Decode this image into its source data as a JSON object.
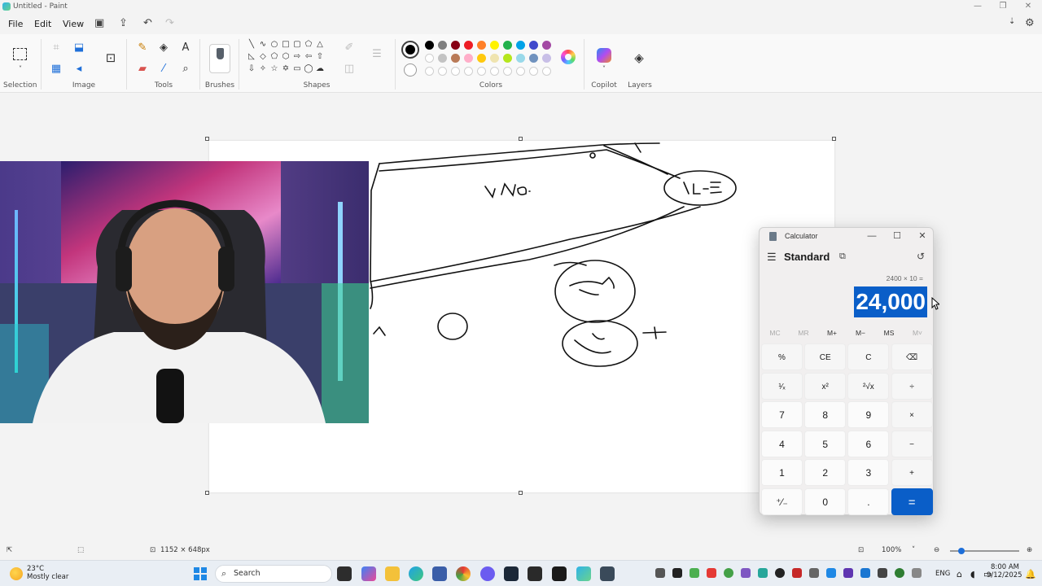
{
  "window": {
    "title": "Untitled - Paint"
  },
  "menu": {
    "file": "File",
    "edit": "Edit",
    "view": "View"
  },
  "ribbon": {
    "groups": {
      "selection": "Selection",
      "image": "Image",
      "tools": "Tools",
      "brushes": "Brushes",
      "shapes": "Shapes",
      "colors": "Colors",
      "copilot": "Copilot",
      "layers": "Layers"
    },
    "palette_row1": [
      "#000000",
      "#7f7f7f",
      "#880015",
      "#ed1c24",
      "#ff7f27",
      "#fff200",
      "#22b14c",
      "#00a2e8",
      "#3f48cc",
      "#a349a4"
    ],
    "palette_row2": [
      "#ffffff",
      "#c3c3c3",
      "#b97a57",
      "#ffaec9",
      "#ffc90e",
      "#efe4b0",
      "#b5e61d",
      "#99d9ea",
      "#7092be",
      "#c8bfe7"
    ]
  },
  "status": {
    "canvas_size": "1152 × 648px",
    "zoom": "100%"
  },
  "calculator": {
    "title": "Calculator",
    "mode": "Standard",
    "expression": "2400 × 10 =",
    "display": "24,000",
    "memory": [
      "MC",
      "MR",
      "M+",
      "M−",
      "MS",
      "M˅"
    ],
    "keys": [
      [
        "%",
        "CE",
        "C",
        "⌫"
      ],
      [
        "¹⁄ₓ",
        "x²",
        "²√x",
        "÷"
      ],
      [
        "7",
        "8",
        "9",
        "×"
      ],
      [
        "4",
        "5",
        "6",
        "−"
      ],
      [
        "1",
        "2",
        "3",
        "+"
      ],
      [
        "⁺⁄₋",
        "0",
        ".",
        "="
      ]
    ]
  },
  "taskbar": {
    "weather_temp": "23°C",
    "weather_desc": "Mostly clear",
    "search_label": "Search",
    "language": "ENG",
    "time": "8:00 AM",
    "date": "9/12/2025"
  },
  "icons": {
    "back-icon": "‹",
    "undo": "↶",
    "redo": "↷",
    "save": "💾",
    "share": "⤴",
    "settings": "⚙",
    "search": "⌕",
    "history": "🕑"
  }
}
